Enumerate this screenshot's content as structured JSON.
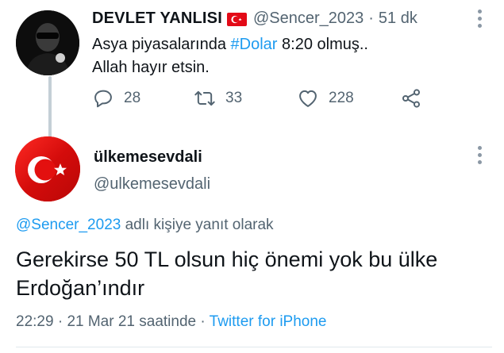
{
  "tweet": {
    "author_name": "DEVLET YANLISI",
    "author_flag_icon": "turkey-flag-icon",
    "author_handle": "@Sencer_2023",
    "separator": "·",
    "time_ago": "51 dk",
    "text_before_hashtag": "Asya piyasalarında ",
    "hashtag": "#Dolar",
    "text_after_hashtag": " 8:20 olmuş..",
    "text_line2": "Allah hayır etsin.",
    "reply_count": "28",
    "retweet_count": "33",
    "like_count": "228"
  },
  "reply": {
    "author_name": "ülkemesevdali",
    "author_handle": "@ulkemesevdali",
    "reply_to_handle": "@Sencer_2023",
    "reply_to_suffix": " adlı kişiye yanıt olarak",
    "text": "Gerekirse 50 TL olsun hiç önemi yok bu ülke Erdoğan’ındır",
    "time": "22:29",
    "date": "21 Mar 21 saatinde",
    "separator": " · ",
    "source": "Twitter for iPhone"
  },
  "colors": {
    "link": "#1d9bf0",
    "secondary_text": "#536471",
    "flag_red": "#e30a17"
  }
}
